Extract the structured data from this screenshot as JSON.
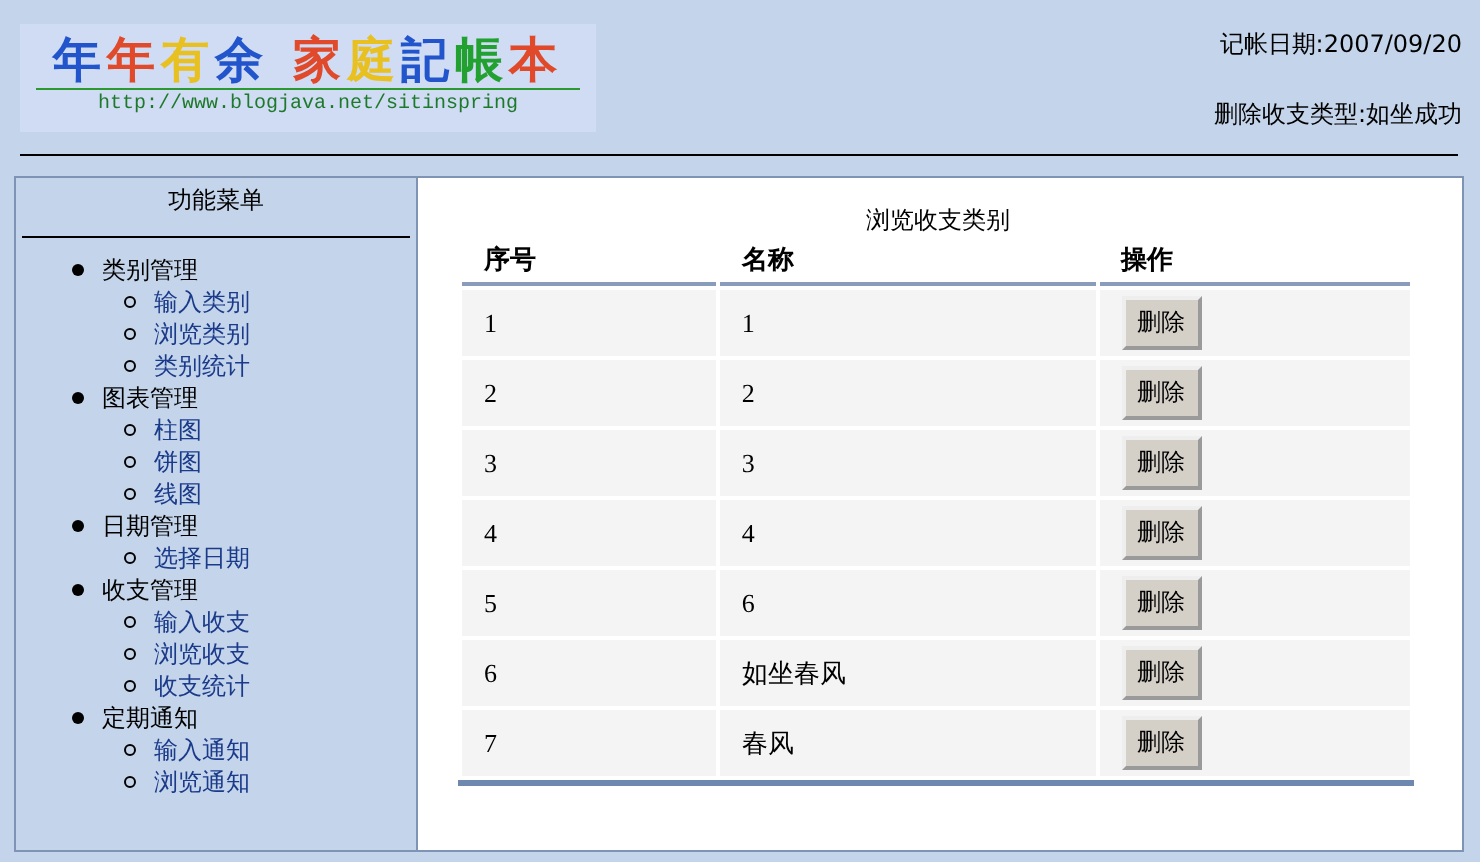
{
  "logo": {
    "words": [
      {
        "chars": [
          {
            "char": "年",
            "color": "#2255cc"
          },
          {
            "char": "年",
            "color": "#e04a2a"
          },
          {
            "char": "有",
            "color": "#e8c020"
          },
          {
            "char": "余",
            "color": "#2255cc"
          }
        ]
      },
      {
        "chars": [
          {
            "char": "家",
            "color": "#e04a2a"
          },
          {
            "char": "庭",
            "color": "#e8c020"
          },
          {
            "char": "記",
            "color": "#2255cc"
          },
          {
            "char": "帳",
            "color": "#22a030"
          },
          {
            "char": "本",
            "color": "#e04a2a"
          }
        ]
      }
    ],
    "url": "http://www.blogjava.net/sitinspring"
  },
  "header": {
    "date": "记帐日期:2007/09/20",
    "message": "删除收支类型:如坐成功"
  },
  "sidebar": {
    "title": "功能菜单",
    "groups": [
      {
        "label": "类别管理",
        "children": [
          {
            "label": "输入类别"
          },
          {
            "label": "浏览类别"
          },
          {
            "label": "类别统计"
          }
        ]
      },
      {
        "label": "图表管理",
        "children": [
          {
            "label": "柱图"
          },
          {
            "label": "饼图"
          },
          {
            "label": "线图"
          }
        ]
      },
      {
        "label": "日期管理",
        "children": [
          {
            "label": "选择日期"
          }
        ]
      },
      {
        "label": "收支管理",
        "children": [
          {
            "label": "输入收支"
          },
          {
            "label": "浏览收支"
          },
          {
            "label": "收支统计"
          }
        ]
      },
      {
        "label": "定期通知",
        "children": [
          {
            "label": "输入通知"
          },
          {
            "label": "浏览通知"
          }
        ]
      }
    ]
  },
  "table": {
    "caption": "浏览收支类别",
    "columns": [
      "序号",
      "名称",
      "操作"
    ],
    "rows": [
      {
        "id": "1",
        "name": "1",
        "action": "删除"
      },
      {
        "id": "2",
        "name": "2",
        "action": "删除"
      },
      {
        "id": "3",
        "name": "3",
        "action": "删除"
      },
      {
        "id": "4",
        "name": "4",
        "action": "删除"
      },
      {
        "id": "5",
        "name": "6",
        "action": "删除"
      },
      {
        "id": "6",
        "name": "如坐春风",
        "action": "删除"
      },
      {
        "id": "7",
        "name": "春风",
        "action": "删除"
      }
    ]
  }
}
